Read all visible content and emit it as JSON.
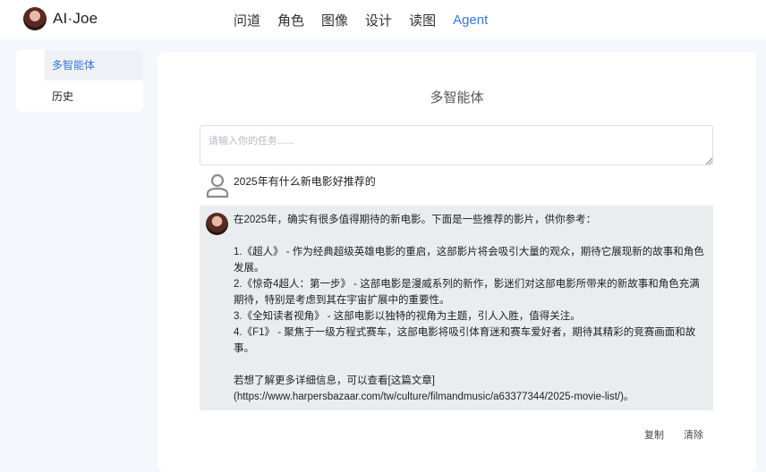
{
  "brand": {
    "name": "AI·Joe"
  },
  "nav": {
    "items": [
      "问道",
      "角色",
      "图像",
      "设计",
      "读图",
      "Agent"
    ]
  },
  "sidebar": {
    "items": [
      {
        "label": "多智能体"
      },
      {
        "label": "历史"
      }
    ]
  },
  "main": {
    "title": "多智能体",
    "task_input": {
      "placeholder": "请输入你的任务......",
      "value": ""
    },
    "user_message": "2025年有什么新电影好推荐的",
    "reply": {
      "intro": "在2025年，确实有很多值得期待的新电影。下面是一些推荐的影片，供你参考：",
      "items": [
        "1.《超人》 - 作为经典超级英雄电影的重启，这部影片将会吸引大量的观众，期待它展现新的故事和角色发展。",
        "2.《惊奇4超人：第一步》 - 这部电影是漫威系列的新作，影迷们对这部电影所带来的新故事和角色充满期待，特别是考虑到其在宇宙扩展中的重要性。",
        "3.《全知读者视角》 - 这部电影以独特的视角为主题，引人入胜，值得关注。",
        "4.《F1》 - 聚焦于一级方程式赛车，这部电影将吸引体育迷和赛车爱好者，期待其精彩的竞赛画面和故事。"
      ],
      "outro_line1": "若想了解更多详细信息，可以查看[这篇文章]",
      "outro_line2": "(https://www.harpersbazaar.com/tw/culture/filmandmusic/a63377344/2025-movie-list/)。"
    },
    "actions": {
      "copy": "复制",
      "clear": "清除"
    }
  },
  "colors": {
    "accent": "#3a77d6",
    "reply_bg": "#e9edf0",
    "page_bg": "#f4f7fc"
  }
}
